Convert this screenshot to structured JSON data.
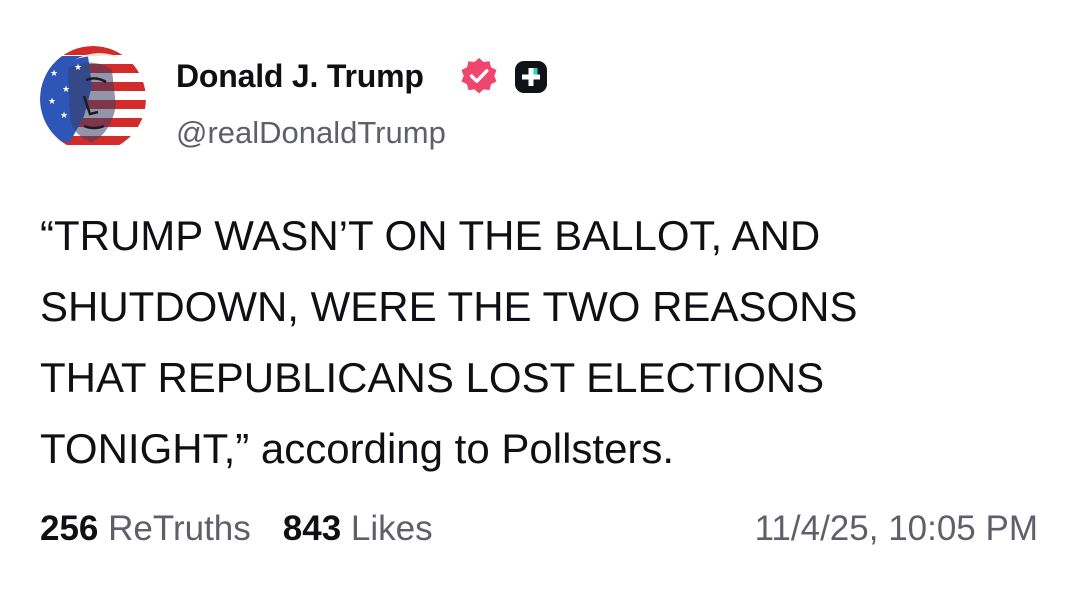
{
  "author": {
    "display_name": "Donald J. Trump",
    "handle": "@realDonaldTrump",
    "verified_color": "#f0466e",
    "badge_icon": "plus-badge-icon"
  },
  "post": {
    "lines": [
      "“TRUMP WASN’T ON THE BALLOT, AND",
      "SHUTDOWN, WERE THE TWO REASONS",
      "THAT REPUBLICANS LOST ELECTIONS",
      "TONIGHT,” according to Pollsters."
    ]
  },
  "stats": {
    "retruths_count": "256",
    "retruths_label": "ReTruths",
    "likes_count": "843",
    "likes_label": "Likes"
  },
  "timestamp": "11/4/25, 10:05 PM",
  "colors": {
    "text": "#0f0f14",
    "muted": "#5f5f6a",
    "background": "#ffffff"
  }
}
